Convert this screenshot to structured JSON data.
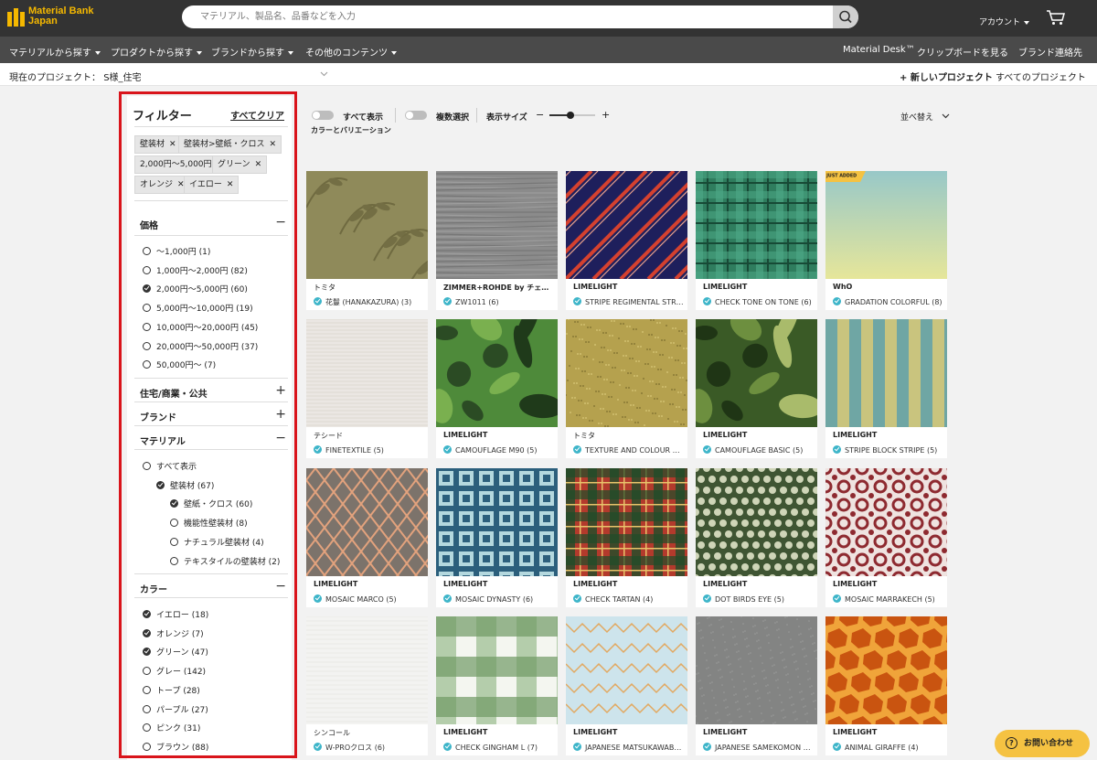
{
  "header": {
    "logo_line1": "Material Bank",
    "logo_line2": "Japan",
    "search_placeholder": "マテリアル、製品名、品番などを入力",
    "account_label": "アカウント"
  },
  "nav": {
    "left": [
      "マテリアルから探す",
      "プロダクトから探す",
      "ブランドから探す",
      "その他のコンテンツ"
    ],
    "right": [
      "Material Desk™",
      "クリップボードを見る",
      "ブランド連絡先"
    ]
  },
  "project": {
    "current_label": "現在のプロジェクト：",
    "current_value": "S様_住宅",
    "new_project": "+ 新しいプロジェクト",
    "all_projects": "すべてのプロジェクト"
  },
  "filter": {
    "title": "フィルター",
    "clear_all": "すべてクリア",
    "chips": [
      "壁装材",
      "壁装材>壁紙・クロス",
      "2,000円〜5,000円",
      "グリーン",
      "オレンジ",
      "イエロー"
    ],
    "price": {
      "title": "価格",
      "options": [
        {
          "label": "〜1,000円 (1)",
          "checked": false
        },
        {
          "label": "1,000円〜2,000円 (82)",
          "checked": false
        },
        {
          "label": "2,000円〜5,000円 (60)",
          "checked": true
        },
        {
          "label": "5,000円〜10,000円 (19)",
          "checked": false
        },
        {
          "label": "10,000円〜20,000円 (45)",
          "checked": false
        },
        {
          "label": "20,000円〜50,000円 (37)",
          "checked": false
        },
        {
          "label": "50,000円〜 (7)",
          "checked": false
        }
      ]
    },
    "collapsed_sections": [
      "住宅/商業・公共",
      "ブランド"
    ],
    "material": {
      "title": "マテリアル",
      "options": [
        {
          "label": "すべて表示",
          "checked": false,
          "level": 0
        },
        {
          "label": "壁装材 (67)",
          "checked": true,
          "level": 1
        },
        {
          "label": "壁紙・クロス (60)",
          "checked": true,
          "level": 2
        },
        {
          "label": "機能性壁装材 (8)",
          "checked": false,
          "level": 2
        },
        {
          "label": "ナチュラル壁装材 (4)",
          "checked": false,
          "level": 2
        },
        {
          "label": "テキスタイルの壁装材 (2)",
          "checked": false,
          "level": 2
        }
      ]
    },
    "color": {
      "title": "カラー",
      "options": [
        {
          "label": "イエロー (18)",
          "checked": true
        },
        {
          "label": "オレンジ (7)",
          "checked": true
        },
        {
          "label": "グリーン (47)",
          "checked": true
        },
        {
          "label": "グレー (142)",
          "checked": false
        },
        {
          "label": "トープ (28)",
          "checked": false
        },
        {
          "label": "パープル (27)",
          "checked": false
        },
        {
          "label": "ピンク (31)",
          "checked": false
        },
        {
          "label": "ブラウン (88)",
          "checked": false
        }
      ]
    }
  },
  "toolbar": {
    "show_all": "すべて表示",
    "color_variation": "カラーとバリエーション",
    "multi_select": "複数選択",
    "display_size": "表示サイズ",
    "minus": "−",
    "plus": "+",
    "sort": "並べ替え",
    "size_level": 0.45
  },
  "badge_text": "JUST ADDED",
  "products": [
    {
      "brand": "トミタ",
      "name": "花鬘 (HANAKAZURA) (3)",
      "pattern": "leaf"
    },
    {
      "brand": "ZIMMER+ROHDE by チェ…",
      "name": "ZW1011 (6)",
      "pattern": "grey"
    },
    {
      "brand": "LIMELIGHT",
      "name": "STRIPE REGIMENTAL STR…",
      "pattern": "regimental"
    },
    {
      "brand": "LIMELIGHT",
      "name": "CHECK TONE ON TONE (6)",
      "pattern": "plaid"
    },
    {
      "brand": "WhO",
      "name": "GRADATION COLORFUL (8)",
      "pattern": "gradation",
      "badge": true
    },
    {
      "brand": "テシード",
      "name": "FINETEXTILE (5)",
      "pattern": "linen"
    },
    {
      "brand": "LIMELIGHT",
      "name": "CAMOUFLAGE M90 (5)",
      "pattern": "camo1"
    },
    {
      "brand": "トミタ",
      "name": "TEXTURE AND COLOUR …",
      "pattern": "speckle"
    },
    {
      "brand": "LIMELIGHT",
      "name": "CAMOUFLAGE BASIC (5)",
      "pattern": "camo2"
    },
    {
      "brand": "LIMELIGHT",
      "name": "STRIPE BLOCK STRIPE (5)",
      "pattern": "block"
    },
    {
      "brand": "LIMELIGHT",
      "name": "MOSAIC MARCO (5)",
      "pattern": "diamond"
    },
    {
      "brand": "LIMELIGHT",
      "name": "MOSAIC DYNASTY (6)",
      "pattern": "tile"
    },
    {
      "brand": "LIMELIGHT",
      "name": "CHECK TARTAN (4)",
      "pattern": "tartan"
    },
    {
      "brand": "LIMELIGHT",
      "name": "DOT BIRDS EYE (5)",
      "pattern": "dots"
    },
    {
      "brand": "LIMELIGHT",
      "name": "MOSAIC MARRAKECH (5)",
      "pattern": "marrakech"
    },
    {
      "brand": "シンコール",
      "name": "W-PROクロス (6)",
      "pattern": "white"
    },
    {
      "brand": "LIMELIGHT",
      "name": "CHECK GINGHAM L (7)",
      "pattern": "gingham"
    },
    {
      "brand": "LIMELIGHT",
      "name": "JAPANESE MATSUKAWAB…",
      "pattern": "zigzag"
    },
    {
      "brand": "LIMELIGHT",
      "name": "JAPANESE SAMEKOMON …",
      "pattern": "samekomon"
    },
    {
      "brand": "LIMELIGHT",
      "name": "ANIMAL GIRAFFE (4)",
      "pattern": "giraffe"
    }
  ],
  "help_button": "お問い合わせ",
  "help_q": "?"
}
